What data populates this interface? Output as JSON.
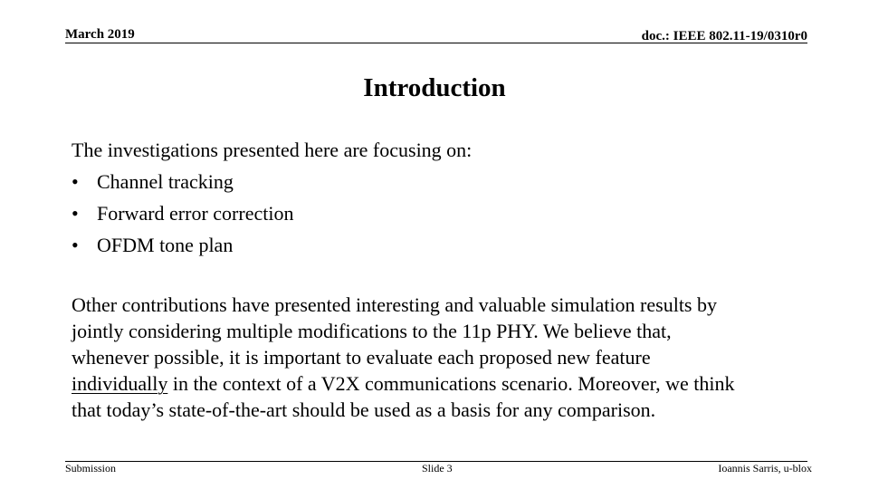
{
  "header": {
    "date": "March 2019",
    "doc_id": "doc.: IEEE 802.11-19/0310r0"
  },
  "slide": {
    "title": "Introduction",
    "intro": "The investigations presented here are focusing on:",
    "bullet_symbol": "•",
    "bullets": [
      "Channel tracking",
      "Forward error correction",
      "OFDM tone plan"
    ],
    "paragraph": {
      "line1": "Other contributions have presented interesting and valuable simulation results by",
      "line2": "jointly considering multiple modifications to the 11p PHY. We believe that,",
      "line3": "whenever possible, it is important to evaluate each proposed new feature",
      "line4_underlined": "individually",
      "line4_rest": " in the context of a V2X communications scenario. Moreover, we think",
      "line5": "that today’s state-of-the-art should be used as a basis for any comparison."
    }
  },
  "footer": {
    "left": "Submission",
    "center": "Slide 3",
    "right": "Ioannis Sarris, u-blox"
  }
}
